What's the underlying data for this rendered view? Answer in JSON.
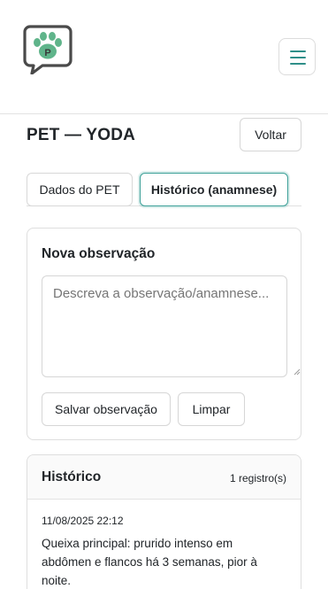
{
  "navbar": {
    "logo_icon": "paw-chat-bubble-icon",
    "menu_icon": "hamburger-menu-icon",
    "accent_color": "#2f8f89"
  },
  "page": {
    "title": "PET — YODA",
    "back_label": "Voltar"
  },
  "tabs": [
    {
      "label": "Dados do PET",
      "active": false
    },
    {
      "label": "Histórico (anamnese)",
      "active": true
    }
  ],
  "new_observation": {
    "title": "Nova observação",
    "placeholder": "Descreva a observação/anamnese...",
    "value": "",
    "save_label": "Salvar observação",
    "clear_label": "Limpar"
  },
  "history": {
    "title": "Histórico",
    "count": "1 registro(s)",
    "entries": [
      {
        "date": "11/08/2025 22:12",
        "text": "Queixa principal: prurido intenso em abdômen e flancos há 3 semanas, pior à noite."
      }
    ]
  }
}
